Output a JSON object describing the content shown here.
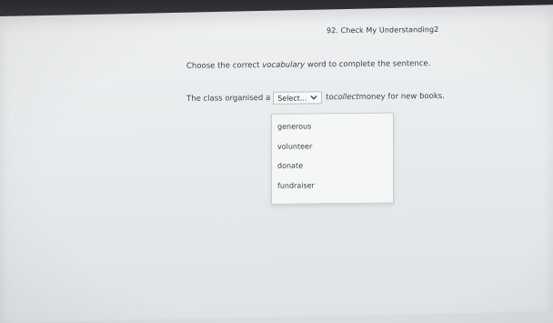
{
  "question": {
    "header": "92. Check My Understanding2"
  },
  "instruction": {
    "before": "Choose the correct ",
    "italic": "vocabulary",
    "after": " word to complete the sentence."
  },
  "sentence": {
    "before": "The class organised a",
    "after_before_italic": "to ",
    "italic": "collect",
    "after": " money for new books."
  },
  "select": {
    "value": "Select...",
    "options": [
      "generous",
      "volunteer",
      "donate",
      "fundraiser"
    ]
  }
}
